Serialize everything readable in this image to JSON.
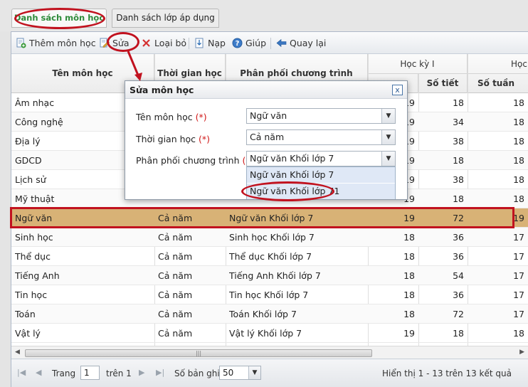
{
  "tabs": [
    {
      "label": "Danh sách môn học",
      "active": true
    },
    {
      "label": "Danh sách lớp áp dụng",
      "active": false
    }
  ],
  "toolbar": {
    "add": "Thêm môn học",
    "edit": "Sửa",
    "remove": "Loại bỏ",
    "load": "Nạp",
    "help": "Giúp",
    "back": "Quay lại"
  },
  "grid": {
    "headers": {
      "subject": "Tên môn học",
      "time": "Thời gian học",
      "plan": "Phân phối chương trình",
      "semester1": "Học kỳ I",
      "semester2": "Học",
      "lessons": "Số tiết",
      "weeks": "Số tuần"
    },
    "rows": [
      {
        "subject": "Âm nhạc",
        "time": "",
        "plan": "",
        "weeks1": "19",
        "lessons1": "18",
        "weeks2": "18"
      },
      {
        "subject": "Công nghệ",
        "time": "",
        "plan": "",
        "weeks1": "19",
        "lessons1": "34",
        "weeks2": "18"
      },
      {
        "subject": "Địa lý",
        "time": "",
        "plan": "",
        "weeks1": "19",
        "lessons1": "38",
        "weeks2": "18"
      },
      {
        "subject": "GDCD",
        "time": "",
        "plan": "",
        "weeks1": "19",
        "lessons1": "18",
        "weeks2": "18"
      },
      {
        "subject": "Lịch sử",
        "time": "",
        "plan": "",
        "weeks1": "19",
        "lessons1": "38",
        "weeks2": "18"
      },
      {
        "subject": "Mỹ thuật",
        "time": "",
        "plan": "",
        "weeks1": "19",
        "lessons1": "18",
        "weeks2": "18"
      },
      {
        "subject": "Ngữ văn",
        "time": "Cả năm",
        "plan": "Ngữ văn Khối lớp 7",
        "weeks1": "19",
        "lessons1": "72",
        "weeks2": "19"
      },
      {
        "subject": "Sinh học",
        "time": "Cả năm",
        "plan": "Sinh học Khối lớp 7",
        "weeks1": "18",
        "lessons1": "36",
        "weeks2": "17"
      },
      {
        "subject": "Thể dục",
        "time": "Cả năm",
        "plan": "Thể dục Khối lớp 7",
        "weeks1": "18",
        "lessons1": "36",
        "weeks2": "17"
      },
      {
        "subject": "Tiếng Anh",
        "time": "Cả năm",
        "plan": "Tiếng Anh Khối lớp 7",
        "weeks1": "18",
        "lessons1": "54",
        "weeks2": "17"
      },
      {
        "subject": "Tin học",
        "time": "Cả năm",
        "plan": "Tin học Khối lớp 7",
        "weeks1": "18",
        "lessons1": "36",
        "weeks2": "17"
      },
      {
        "subject": "Toán",
        "time": "Cả năm",
        "plan": "Toán Khối lớp 7",
        "weeks1": "18",
        "lessons1": "72",
        "weeks2": "17"
      },
      {
        "subject": "Vật lý",
        "time": "Cả năm",
        "plan": "Vật lý Khối lớp 7",
        "weeks1": "19",
        "lessons1": "18",
        "weeks2": "18"
      }
    ]
  },
  "pager": {
    "page_label": "Trang",
    "page_value": "1",
    "of_label": "trên 1",
    "page_size_label": "Số bản ghi",
    "page_size_value": "50",
    "summary": "Hiển thị 1 - 13 trên 13 kết quả"
  },
  "modal": {
    "title": "Sửa môn học",
    "subject_label": "Tên môn học",
    "subject_value": "Ngữ văn",
    "time_label": "Thời gian học",
    "time_value": "Cả năm",
    "plan_label": "Phân phối chương trình",
    "plan_value": "Ngữ văn Khối lớp 7",
    "required_mark": "(*)",
    "close": "x",
    "options": [
      "Ngữ văn Khối lớp 7",
      "Ngữ văn Khối lớp 71"
    ]
  },
  "colors": {
    "selected_row": "#d8b276",
    "annotation": "#c1121f",
    "active_tab_text": "#2e8b3a"
  }
}
